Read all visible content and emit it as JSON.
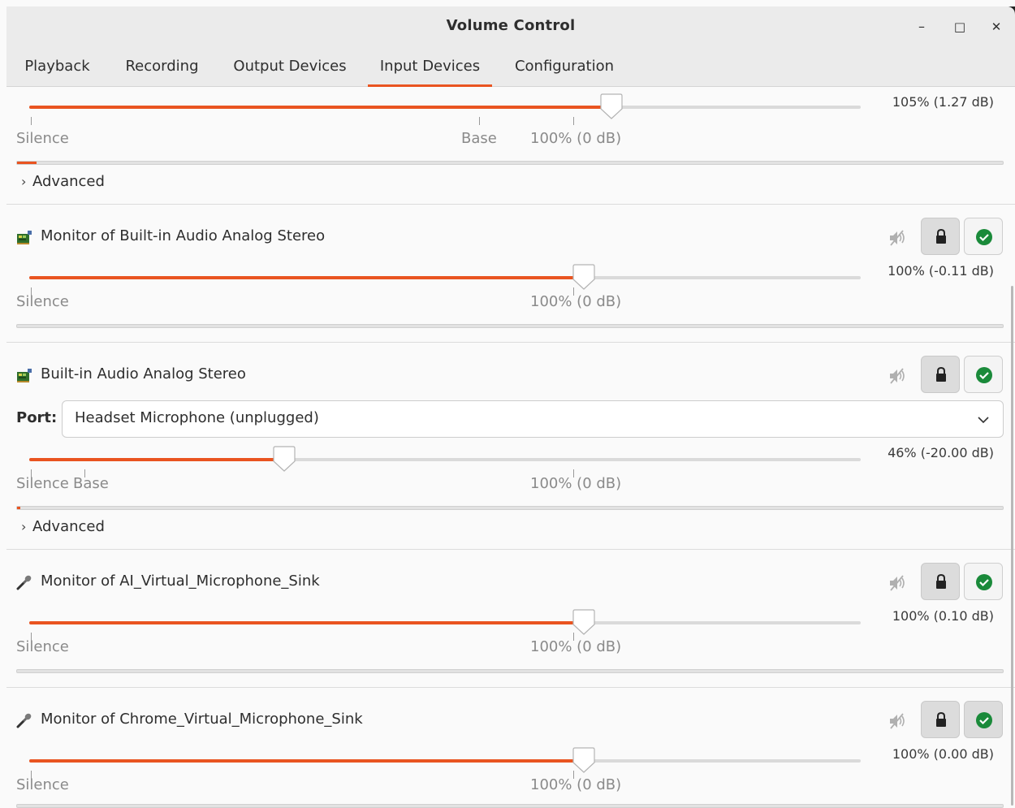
{
  "window": {
    "title": "Volume Control",
    "minimize_glyph": "–",
    "maximize_glyph": "□",
    "close_glyph": "✕"
  },
  "tabs": [
    {
      "label": "Playback"
    },
    {
      "label": "Recording"
    },
    {
      "label": "Output Devices"
    },
    {
      "label": "Input Devices",
      "active": true
    },
    {
      "label": "Configuration"
    }
  ],
  "labels": {
    "silence": "Silence",
    "base": "Base",
    "hundred": "100% (0 dB)",
    "advanced": "Advanced",
    "port": "Port:"
  },
  "devices": [
    {
      "name": "",
      "volume": "105% (1.27 dB)",
      "volume_percent": 105,
      "meter_percent": 2,
      "has_advanced": true
    },
    {
      "name": "Monitor of Built-in Audio Analog Stereo",
      "icon": "sound-card-icon",
      "volume": "100% (-0.11 dB)",
      "volume_percent": 100,
      "meter_percent": 0
    },
    {
      "name": "Built-in Audio Analog Stereo",
      "icon": "sound-card-icon",
      "port": "Headset Microphone (unplugged)",
      "volume": "46% (-20.00 dB)",
      "volume_percent": 46,
      "meter_percent": 0.3,
      "has_advanced": true
    },
    {
      "name": "Monitor of AI_Virtual_Microphone_Sink",
      "icon": "microphone-icon",
      "volume": "100% (0.10 dB)",
      "volume_percent": 100,
      "meter_percent": 0
    },
    {
      "name": "Monitor of Chrome_Virtual_Microphone_Sink",
      "icon": "microphone-icon",
      "volume": "100% (0.00 dB)",
      "volume_percent": 100,
      "meter_percent": 0
    }
  ],
  "colors": {
    "accent": "#e95420",
    "default_check": "#1a8a3a"
  }
}
